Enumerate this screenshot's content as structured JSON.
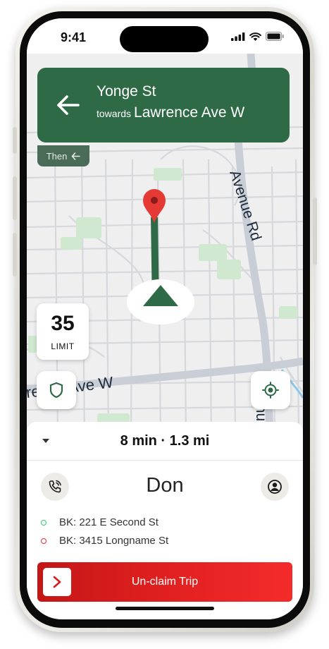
{
  "status_bar": {
    "time": "9:41"
  },
  "navigation": {
    "street": "Yonge St",
    "towards_prefix": "towards",
    "towards_street": "Lawrence Ave W",
    "then_label": "Then"
  },
  "map": {
    "labels": {
      "avenue_rd": "Avenue Rd",
      "lawrence_ave": "rence Ave W"
    },
    "colors": {
      "route": "#2e6a45",
      "pin": "#e53935",
      "park": "#cfe8cf",
      "major_road": "#c9ced6"
    }
  },
  "speed_limit": {
    "value": "35",
    "label": "LIMIT"
  },
  "trip": {
    "eta": "8 min · 1.3 mi",
    "rider_name": "Don",
    "stops": [
      {
        "label": "BK: 221 E Second St",
        "color": "#2ecc71"
      },
      {
        "label": "BK: 3415 Longname St",
        "color": "#e0303a"
      }
    ],
    "unclaim_label": "Un-claim Trip"
  },
  "icons": [
    "back-arrow-icon",
    "then-arrow-icon",
    "shield-icon",
    "crosshair-icon",
    "phone-icon",
    "user-icon",
    "chevron-right-icon",
    "map-pin-icon",
    "navigation-arrow-icon"
  ]
}
